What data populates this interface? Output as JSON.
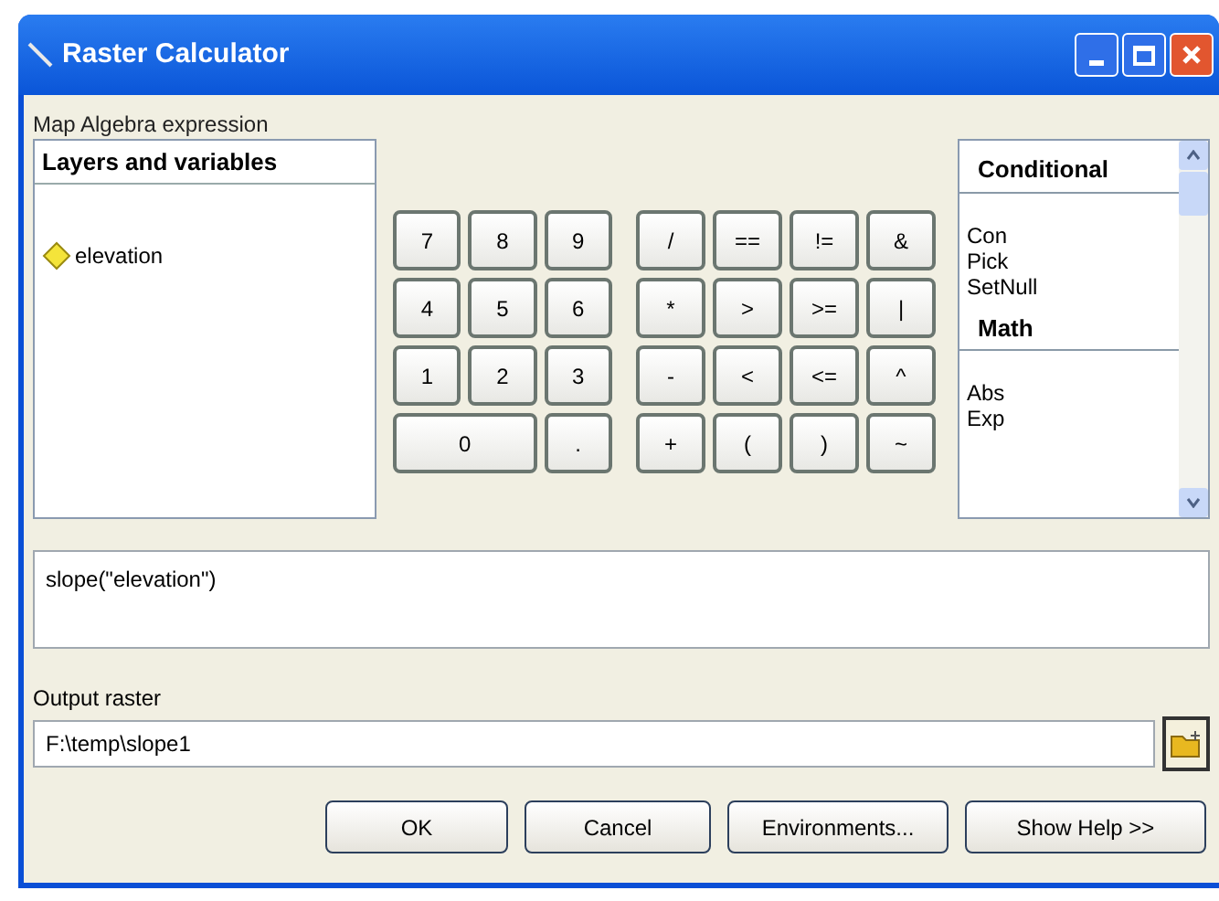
{
  "window": {
    "title": "Raster Calculator"
  },
  "expression_label": "Map Algebra expression",
  "layers": {
    "heading": "Layers and variables",
    "items": [
      {
        "label": "elevation"
      }
    ]
  },
  "number_keys": [
    {
      "label": "7",
      "kind": "key"
    },
    {
      "label": "8",
      "kind": "key"
    },
    {
      "label": "9",
      "kind": "key"
    },
    {
      "label": "4",
      "kind": "key"
    },
    {
      "label": "5",
      "kind": "key"
    },
    {
      "label": "6",
      "kind": "key"
    },
    {
      "label": "1",
      "kind": "key"
    },
    {
      "label": "2",
      "kind": "key"
    },
    {
      "label": "3",
      "kind": "key"
    },
    {
      "label": "0",
      "kind": "wide"
    },
    {
      "label": ".",
      "kind": "key"
    }
  ],
  "operator_keys": [
    "/",
    "==",
    "!=",
    "&",
    "*",
    ">",
    ">=",
    "|",
    "-",
    "<",
    "<=",
    "^",
    "+",
    "(",
    ")",
    "~"
  ],
  "functions": [
    {
      "label": "Conditional",
      "kind": "heading"
    },
    {
      "label": "Con",
      "kind": "item"
    },
    {
      "label": "Pick",
      "kind": "item"
    },
    {
      "label": "SetNull",
      "kind": "item"
    },
    {
      "label": "Math",
      "kind": "heading"
    },
    {
      "label": "Abs",
      "kind": "item"
    },
    {
      "label": "Exp",
      "kind": "item"
    }
  ],
  "expression": "slope(\"elevation\")",
  "output": {
    "label": "Output raster",
    "value": "F:\\temp\\slope1"
  },
  "buttons": [
    "OK",
    "Cancel",
    "Environments...",
    "Show Help >>"
  ]
}
